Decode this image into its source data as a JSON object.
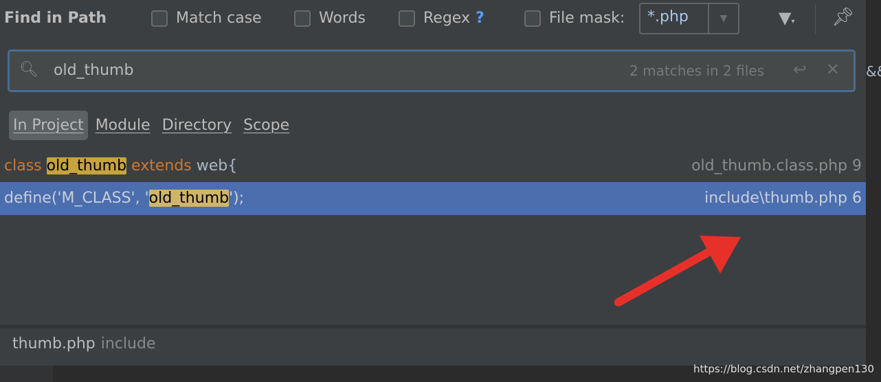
{
  "header": {
    "title": "Find in Path",
    "match_case": "Match case",
    "words": "Words",
    "regex": "Regex",
    "regex_help": "?",
    "file_mask_label": "File mask:",
    "file_mask_value": "*.php"
  },
  "search": {
    "query": "old_thumb",
    "status": "2 matches in 2 files"
  },
  "scopes": [
    "In Project",
    "Module",
    "Directory",
    "Scope"
  ],
  "results": [
    {
      "parts": [
        {
          "t": "class ",
          "c": "kw"
        },
        {
          "t": "old_thumb",
          "c": "hl"
        },
        {
          "t": " extends ",
          "c": "kw"
        },
        {
          "t": "web{",
          "c": "id"
        }
      ],
      "file": "old_thumb.class.php 9",
      "selected": false
    },
    {
      "parts": [
        {
          "t": "define('M_CLASS', '",
          "c": "id"
        },
        {
          "t": "old_thumb",
          "c": "hl"
        },
        {
          "t": "');",
          "c": "id"
        }
      ],
      "file": "include\\thumb.php 6",
      "selected": true
    }
  ],
  "preview": {
    "file": "thumb.php",
    "dir": "include"
  },
  "editor_peek": "&&",
  "watermark": "https://blog.csdn.net/zhangpen130",
  "colors": {
    "selection": "#4b6eaf",
    "highlight": "#c6a33e",
    "annotation_arrow": "#e8302a"
  }
}
